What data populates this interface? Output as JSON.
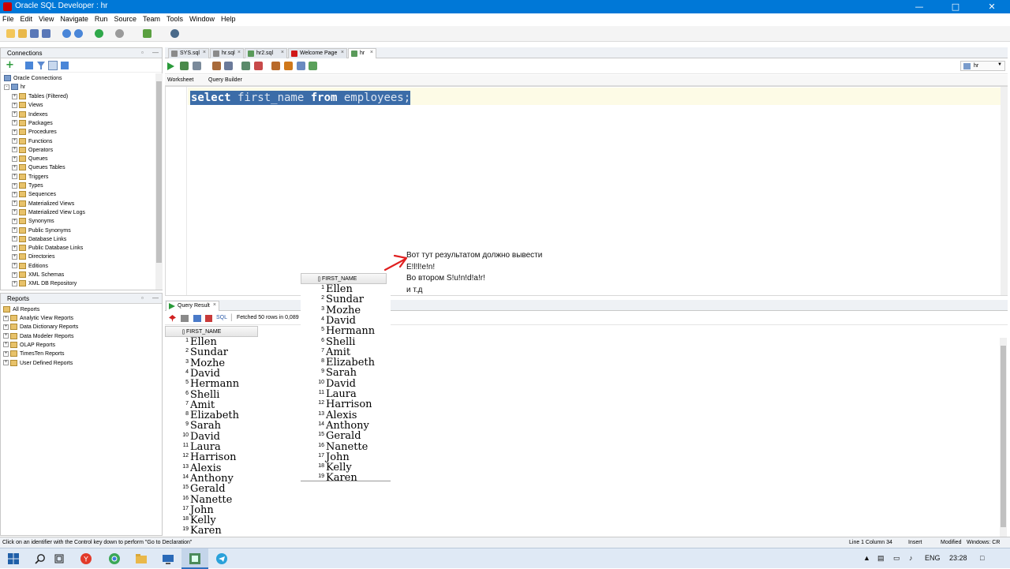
{
  "window": {
    "title": "Oracle SQL Developer : hr"
  },
  "menu": [
    "File",
    "Edit",
    "View",
    "Navigate",
    "Run",
    "Source",
    "Team",
    "Tools",
    "Window",
    "Help"
  ],
  "connections": {
    "title": "Connections",
    "root": "Oracle Connections",
    "connection": "hr",
    "items": [
      "Tables (Filtered)",
      "Views",
      "Indexes",
      "Packages",
      "Procedures",
      "Functions",
      "Operators",
      "Queues",
      "Queues Tables",
      "Triggers",
      "Types",
      "Sequences",
      "Materialized Views",
      "Materialized View Logs",
      "Synonyms",
      "Public Synonyms",
      "Database Links",
      "Public Database Links",
      "Directories",
      "Editions",
      "XML Schemas",
      "XML DB Repository"
    ]
  },
  "reports": {
    "title": "Reports",
    "root": "All Reports",
    "items": [
      "Analytic View Reports",
      "Data Dictionary Reports",
      "Data Modeler Reports",
      "OLAP Reports",
      "TimesTen Reports",
      "User Defined Reports"
    ]
  },
  "tabs": [
    "SYS.sql",
    "hr.sql",
    "hr2.sql",
    "Welcome Page",
    "hr"
  ],
  "editor": {
    "connection_select": "hr",
    "subtabs": [
      "Worksheet",
      "Query Builder"
    ],
    "sql": {
      "kw1": "select",
      "mid": " first_name ",
      "kw2": "from",
      "rest": " employees;"
    }
  },
  "query_result": {
    "tab": "Query Result",
    "sql_label": "SQL",
    "fetch_status": "Fetched 50 rows in 0,089",
    "column": "FIRST_NAME",
    "row_numbers": [
      "1",
      "2",
      "3",
      "4",
      "5",
      "6",
      "7",
      "8",
      "9",
      "10",
      "11",
      "12",
      "13",
      "14",
      "15",
      "16",
      "17",
      "18",
      "19"
    ],
    "rows": [
      "Ellen",
      "Sundar",
      "Mozhe",
      "David",
      "Hermann",
      "Shelli",
      "Amit",
      "Elizabeth",
      "Sarah",
      "David",
      "Laura",
      "Harrison",
      "Alexis",
      "Anthony",
      "Gerald",
      "Nanette",
      "John",
      "Kelly",
      "Karen"
    ]
  },
  "annotation": {
    "lines": [
      "Вот тут результатом должно вывести",
      "E!l!l!e!n!",
      "Во втором S!u!n!d!a!r!",
      "и т.д"
    ],
    "arrow_color": "#e02020"
  },
  "status": {
    "hint": "Click on an identifier with the Control key down to perform \"Go to Declaration\"",
    "position": "Line 1 Column 34",
    "mode": "Insert",
    "modified": "Modified",
    "eol": "Windows: CR"
  },
  "taskbar": {
    "lang": "ENG",
    "time": "23:28"
  },
  "colors": {
    "accent": "#0078d7",
    "selection": "#3b6ca8",
    "current_line": "#fdfbe6"
  }
}
